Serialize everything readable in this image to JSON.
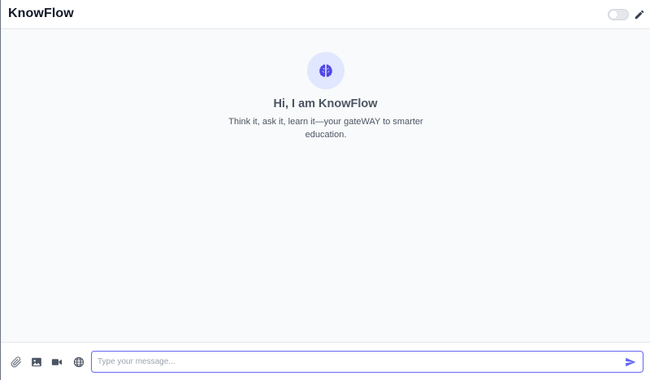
{
  "header": {
    "title": "KnowFlow",
    "toggle_on": false,
    "toggle_icon": "toggle-switch",
    "edit_icon": "pencil-icon"
  },
  "welcome": {
    "avatar_icon": "brain-icon",
    "title": "Hi, I am KnowFlow",
    "subtitle": "Think it, ask it, learn it—your gateWAY to smarter education."
  },
  "composer": {
    "placeholder": "Type your message...",
    "value": "",
    "tools": [
      "paperclip-icon",
      "image-icon",
      "video-icon",
      "globe-icon"
    ],
    "send_icon": "send-icon"
  },
  "colors": {
    "accent": "#6366f1",
    "avatar_bg": "#e0e7ff",
    "icon_gray": "#6b7280",
    "text_gray": "#4b5563",
    "main_bg": "#f9fafb"
  }
}
